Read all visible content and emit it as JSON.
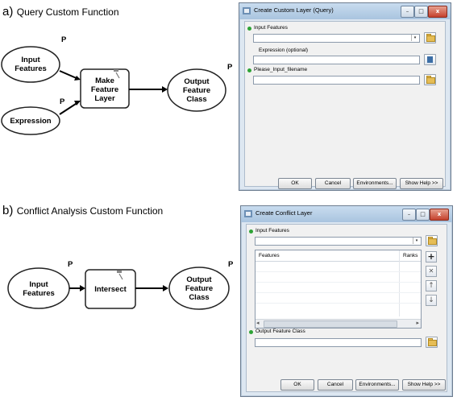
{
  "section_a": {
    "letter": "a)",
    "title": "Query Custom Function"
  },
  "section_b": {
    "letter": "b)",
    "title": "Conflict Analysis Custom Function"
  },
  "model_a": {
    "nodes": {
      "input_features": "Input Features",
      "expression": "Expression",
      "tool": "Make Feature Layer",
      "output": "Output Feature Class"
    },
    "parameter_marker": "P"
  },
  "model_b": {
    "nodes": {
      "input_features": "Input Features",
      "tool": "Intersect",
      "output": "Output Feature Class"
    },
    "parameter_marker": "P"
  },
  "dialog_a": {
    "title": "Create Custom Layer (Query)",
    "fields": {
      "input_features": "Input Features",
      "expression": "Expression (optional)",
      "filename": "Please_Input_filename"
    },
    "buttons": {
      "ok": "OK",
      "cancel": "Cancel",
      "environments": "Environments...",
      "help": "Show Help >>"
    },
    "window_controls": {
      "minimize": "–",
      "maximize": "□",
      "close": "x"
    },
    "dropdown_arrow": "▾"
  },
  "dialog_b": {
    "title": "Create Conflict Layer",
    "fields": {
      "input_features": "Input Features",
      "output": "Output Feature Class"
    },
    "table": {
      "col_features": "Features",
      "col_ranks": "Ranks"
    },
    "side_buttons": {
      "add": "+",
      "remove": "✕",
      "up": "↑",
      "down": "↓"
    },
    "buttons": {
      "ok": "OK",
      "cancel": "Cancel",
      "environments": "Environments...",
      "help": "Show Help >>"
    },
    "window_controls": {
      "minimize": "–",
      "maximize": "□",
      "close": "x"
    },
    "dropdown_arrow": "▾",
    "scroll_arrows": {
      "left": "◂",
      "right": "▸"
    }
  },
  "colors": {
    "required_dot": "#2ea336",
    "window_frame": "#a9c4df",
    "close_button": "#c4402c"
  }
}
